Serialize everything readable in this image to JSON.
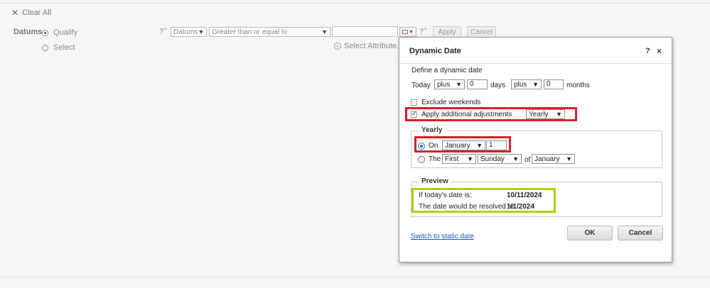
{
  "toolbar": {
    "clear_all": "Clear All"
  },
  "filter": {
    "field_label": "Datums",
    "radio_qualify": "Qualify",
    "radio_select": "Select",
    "attribute_select": "Datums",
    "operator_select": "Greater than or equal to",
    "value": "",
    "help_symbol": "?",
    "apply": "Apply",
    "cancel": "Cancel",
    "select_attribute": "Select Attribute..."
  },
  "dialog": {
    "title": "Dynamic Date",
    "help": "?",
    "close": "×",
    "define_label": "Define a dynamic date",
    "today_label": "Today",
    "days_op": "plus",
    "days_value": "0",
    "days_label": "days",
    "months_op": "plus",
    "months_value": "0",
    "months_label": "months",
    "exclude_weekends": "Exclude weekends",
    "apply_adjustments": "Apply additional adjustments",
    "adjustment_type": "Yearly",
    "yearly_legend": "Yearly",
    "on_label": "On",
    "on_month": "January",
    "on_day": "1",
    "the_label": "The",
    "the_ordinal": "First",
    "the_weekday": "Sunday",
    "of_label": "of",
    "of_month": "January",
    "preview_legend": "Preview",
    "today_is_label": "If today's date is:",
    "today_is_value": "10/11/2024",
    "resolved_label": "The date would be resolved to:",
    "resolved_value": "1/1/2024",
    "switch_link": "Switch to static date",
    "ok": "OK",
    "cancel": "Cancel"
  },
  "colors": {
    "highlight_red": "#e11b25",
    "highlight_green": "#a8d400",
    "link_blue": "#1f56c7"
  }
}
